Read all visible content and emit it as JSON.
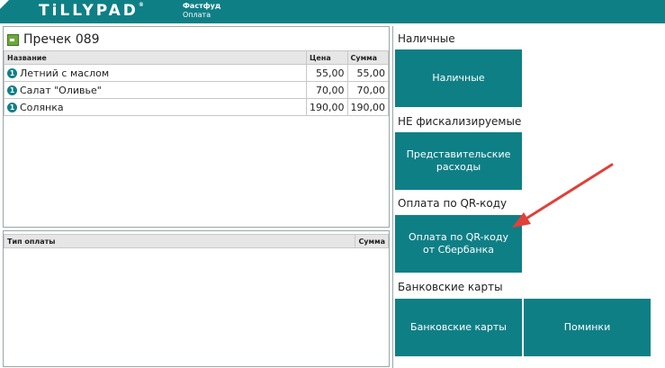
{
  "header": {
    "logo": "TiLLYPAD",
    "context_title": "Фастфуд",
    "context_subtitle": "Оплата"
  },
  "check": {
    "title": "Пречек 089",
    "columns": [
      "Название",
      "Цена",
      "Сумма"
    ],
    "items": [
      {
        "badge": "1",
        "name": "Летний с маслом",
        "price": "55,00",
        "sum": "55,00"
      },
      {
        "badge": "1",
        "name": "Салат \"Оливье\"",
        "price": "70,00",
        "sum": "70,00"
      },
      {
        "badge": "1",
        "name": "Солянка",
        "price": "190,00",
        "sum": "190,00"
      }
    ]
  },
  "payments": {
    "columns": [
      "Тип оплаты",
      "Сумма"
    ]
  },
  "right": {
    "sections": [
      {
        "title": "Наличные",
        "buttons": [
          "Наличные"
        ]
      },
      {
        "title": "НЕ фискализируемые",
        "buttons": [
          "Представительские расходы"
        ]
      },
      {
        "title": "Оплата по QR-коду",
        "buttons": [
          "Оплата по QR-коду от Сбербанка"
        ]
      },
      {
        "title": "Банковские карты",
        "buttons": [
          "Банковские карты",
          "Поминки"
        ]
      }
    ]
  },
  "colors": {
    "accent": "#0f7f86",
    "annotation_arrow": "#e0413a"
  }
}
